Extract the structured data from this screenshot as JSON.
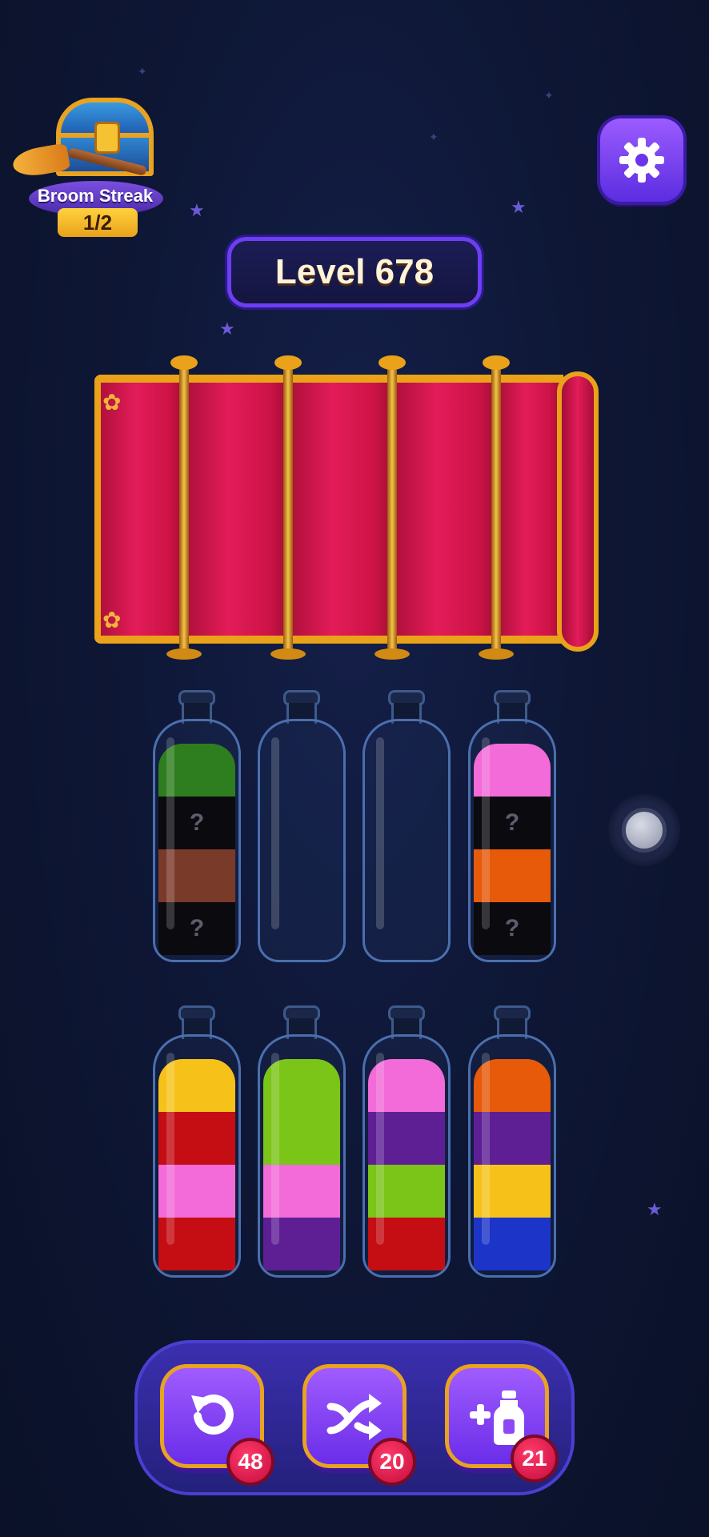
{
  "streak": {
    "label": "Broom Streak",
    "progress": "1/2",
    "icon": "treasure-chest-icon"
  },
  "settings": {
    "icon": "gear-icon"
  },
  "level": {
    "label": "Level 678"
  },
  "colors": {
    "green": "#2e7d1f",
    "black": "#0b0b0f",
    "brown": "#7a3a2a",
    "pink": "#f26bd8",
    "orange": "#e65a0a",
    "yellow": "#f6c21a",
    "red": "#c40e14",
    "lime": "#7bc418",
    "purple": "#5e1f95",
    "blue": "#1c35c8"
  },
  "bottles_row1": [
    {
      "layers": [
        "black",
        "brown",
        "black",
        "green"
      ],
      "hidden": [
        true,
        false,
        true,
        false
      ]
    },
    {
      "layers": [],
      "hidden": []
    },
    {
      "layers": [],
      "hidden": []
    },
    {
      "layers": [
        "black",
        "orange",
        "black",
        "pink"
      ],
      "hidden": [
        true,
        false,
        true,
        false
      ]
    }
  ],
  "bottles_row2": [
    {
      "layers": [
        "red",
        "pink",
        "red",
        "yellow"
      ]
    },
    {
      "layers": [
        "purple",
        "pink",
        "lime",
        "lime"
      ]
    },
    {
      "layers": [
        "red",
        "lime",
        "purple",
        "pink"
      ]
    },
    {
      "layers": [
        "blue",
        "yellow",
        "purple",
        "orange"
      ]
    }
  ],
  "hidden_mark": "?",
  "tools": {
    "undo": {
      "count": "48",
      "icon": "undo-icon"
    },
    "shuffle": {
      "count": "20",
      "icon": "shuffle-icon"
    },
    "add_bottle": {
      "count": "21",
      "icon": "add-bottle-icon"
    }
  }
}
